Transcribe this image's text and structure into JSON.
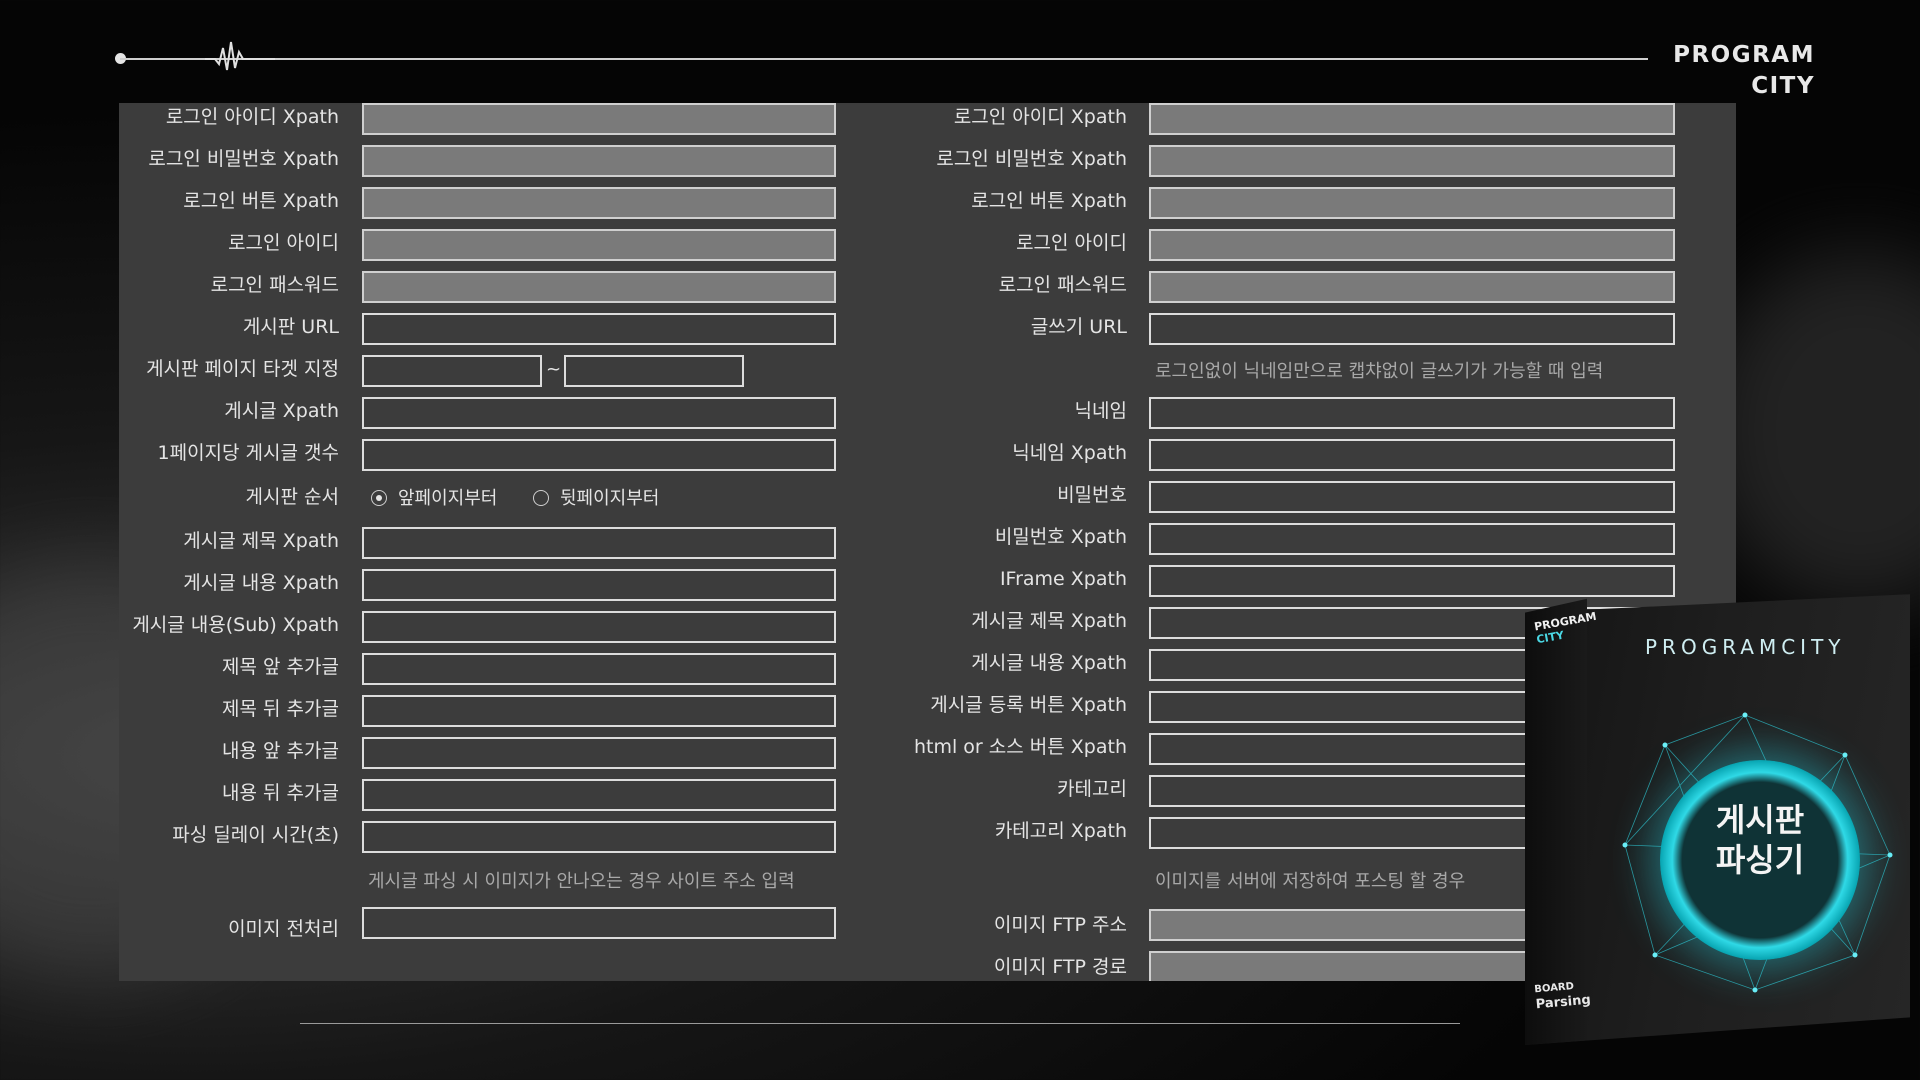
{
  "brand": {
    "line1": "PROGRAM",
    "line2": "CITY"
  },
  "left_fields": [
    {
      "label": "로그인 아이디 Xpath"
    },
    {
      "label": "로그인 비밀번호 Xpath"
    },
    {
      "label": "로그인 버튼 Xpath"
    },
    {
      "label": "로그인 아이디"
    },
    {
      "label": "로그인 패스워드"
    },
    {
      "label": "게시판 URL"
    },
    {
      "label": "게시판 페이지 타겟 지정",
      "range_sep": "~"
    },
    {
      "label": "게시글 Xpath"
    },
    {
      "label": "1페이지당 게시글 갯수"
    },
    {
      "label": "게시판 순서"
    },
    {
      "label": "게시글 제목 Xpath"
    },
    {
      "label": "게시글 내용 Xpath"
    },
    {
      "label": "게시글 내용(Sub) Xpath"
    },
    {
      "label": "제목 앞 추가글"
    },
    {
      "label": "제목 뒤 추가글"
    },
    {
      "label": "내용 앞 추가글"
    },
    {
      "label": "내용 뒤 추가글"
    },
    {
      "label": "파싱 딜레이 시간(초)"
    },
    {
      "label": "이미지 전처리"
    }
  ],
  "board_order": {
    "option1": "앞페이지부터",
    "option2": "뒷페이지부터",
    "selected": "앞페이지부터"
  },
  "left_hint": "게시글 파싱 시 이미지가 안나오는 경우 사이트 주소 입력",
  "right_fields": [
    {
      "label": "로그인 아이디 Xpath"
    },
    {
      "label": "로그인 비밀번호 Xpath"
    },
    {
      "label": "로그인 버튼 Xpath"
    },
    {
      "label": "로그인 아이디"
    },
    {
      "label": "로그인 패스워드"
    },
    {
      "label": "글쓰기 URL"
    },
    {
      "label": "닉네임"
    },
    {
      "label": "닉네임 Xpath"
    },
    {
      "label": "비밀번호"
    },
    {
      "label": "비밀번호 Xpath"
    },
    {
      "label": "IFrame Xpath"
    },
    {
      "label": "게시글 제목 Xpath"
    },
    {
      "label": "게시글 내용 Xpath"
    },
    {
      "label": "게시글 등록 버튼 Xpath"
    },
    {
      "label": "html or 소스 버튼 Xpath"
    },
    {
      "label": "카테고리"
    },
    {
      "label": "카테고리 Xpath"
    },
    {
      "label": "이미지 FTP 주소"
    },
    {
      "label": "이미지 FTP 경로"
    }
  ],
  "right_hint_1": "로그인없이 닉네임만으로 캡챠없이 글쓰기가 가능할 때 입력",
  "right_hint_2": "이미지를 서버에 저장하여 포스팅 할 경우",
  "product_box": {
    "side_line1": "PROGRAM",
    "side_line2": "CITY",
    "title": "PROGRAMCITY",
    "name_line1": "게시판",
    "name_line2": "파싱기",
    "bottom_line1": "BOARD",
    "bottom_line2": "Parsing"
  }
}
